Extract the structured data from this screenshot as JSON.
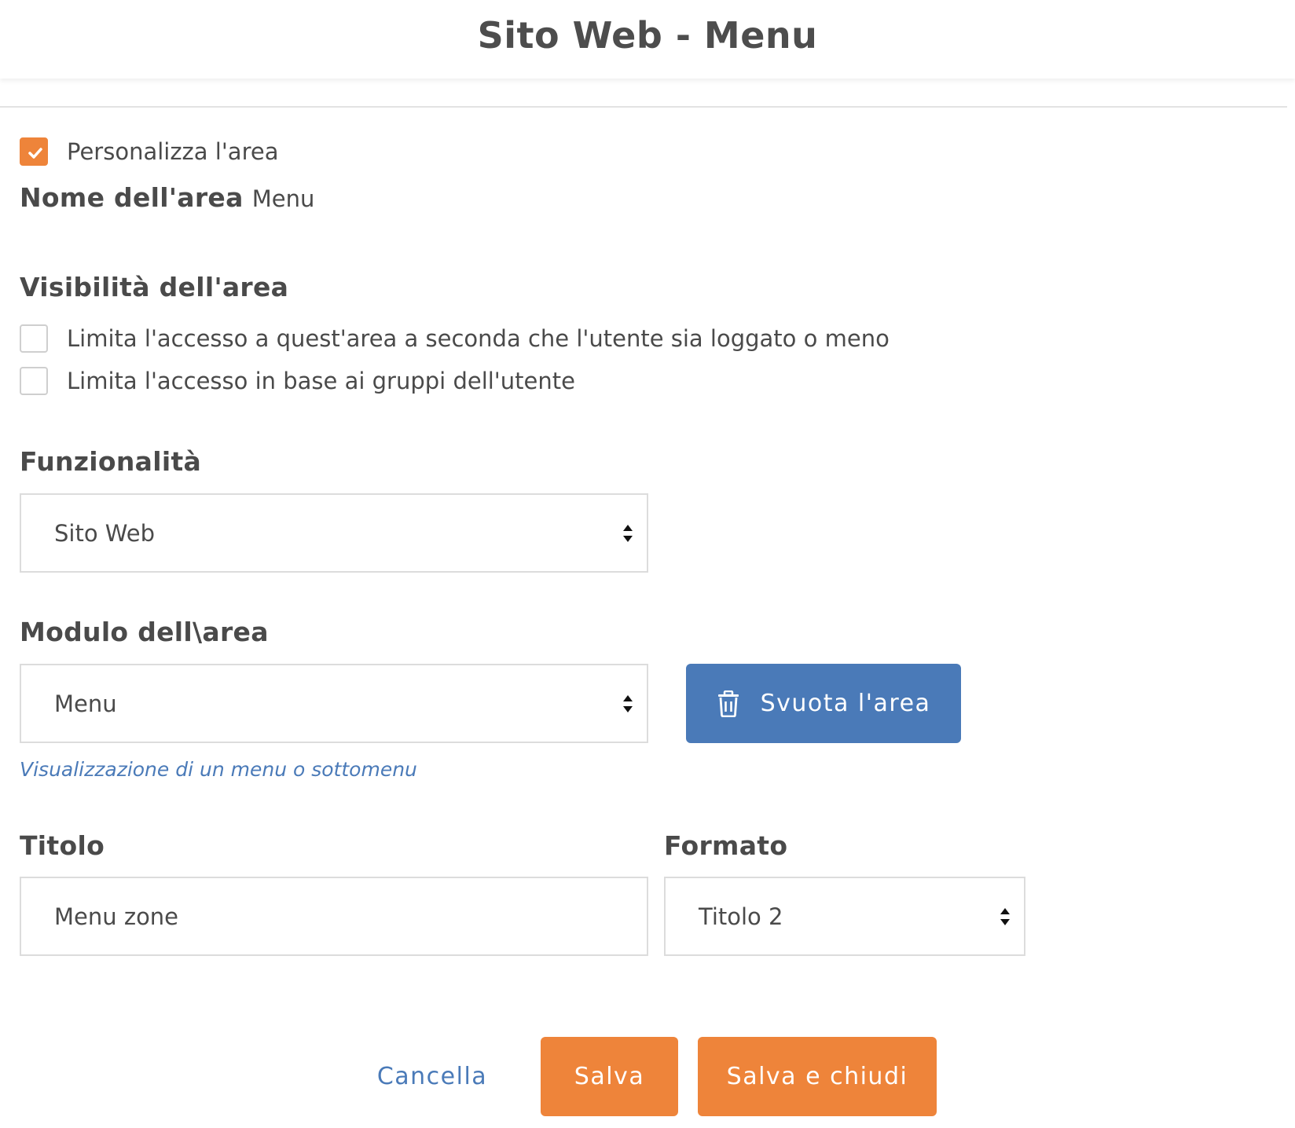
{
  "header": {
    "title": "Sito Web - Menu"
  },
  "customize": {
    "label": "Personalizza l'area",
    "checked": true
  },
  "area_name": {
    "label": "Nome dell'area",
    "value": "Menu"
  },
  "visibility": {
    "title": "Visibilità dell'area",
    "options": [
      {
        "label": "Limita l'accesso a quest'area a seconda che l'utente sia loggato o meno",
        "checked": false
      },
      {
        "label": "Limita l'accesso in base ai gruppi dell'utente",
        "checked": false
      }
    ]
  },
  "functionality": {
    "label": "Funzionalità",
    "value": "Sito Web"
  },
  "module": {
    "label": "Modulo dell\\area",
    "value": "Menu",
    "hint": "Visualizzazione di un menu o sottomenu",
    "clear_button": "Svuota l'area",
    "clear_icon": "trash-icon"
  },
  "title_field": {
    "label": "Titolo",
    "value": "Menu zone"
  },
  "format_field": {
    "label": "Formato",
    "value": "Titolo 2"
  },
  "actions": {
    "cancel": "Cancella",
    "save": "Salva",
    "save_close": "Salva e chiudi"
  },
  "colors": {
    "accent_orange": "#ee843a",
    "accent_blue": "#4a7ab8",
    "text": "#4a4a4a",
    "border": "#dcdcdc"
  }
}
